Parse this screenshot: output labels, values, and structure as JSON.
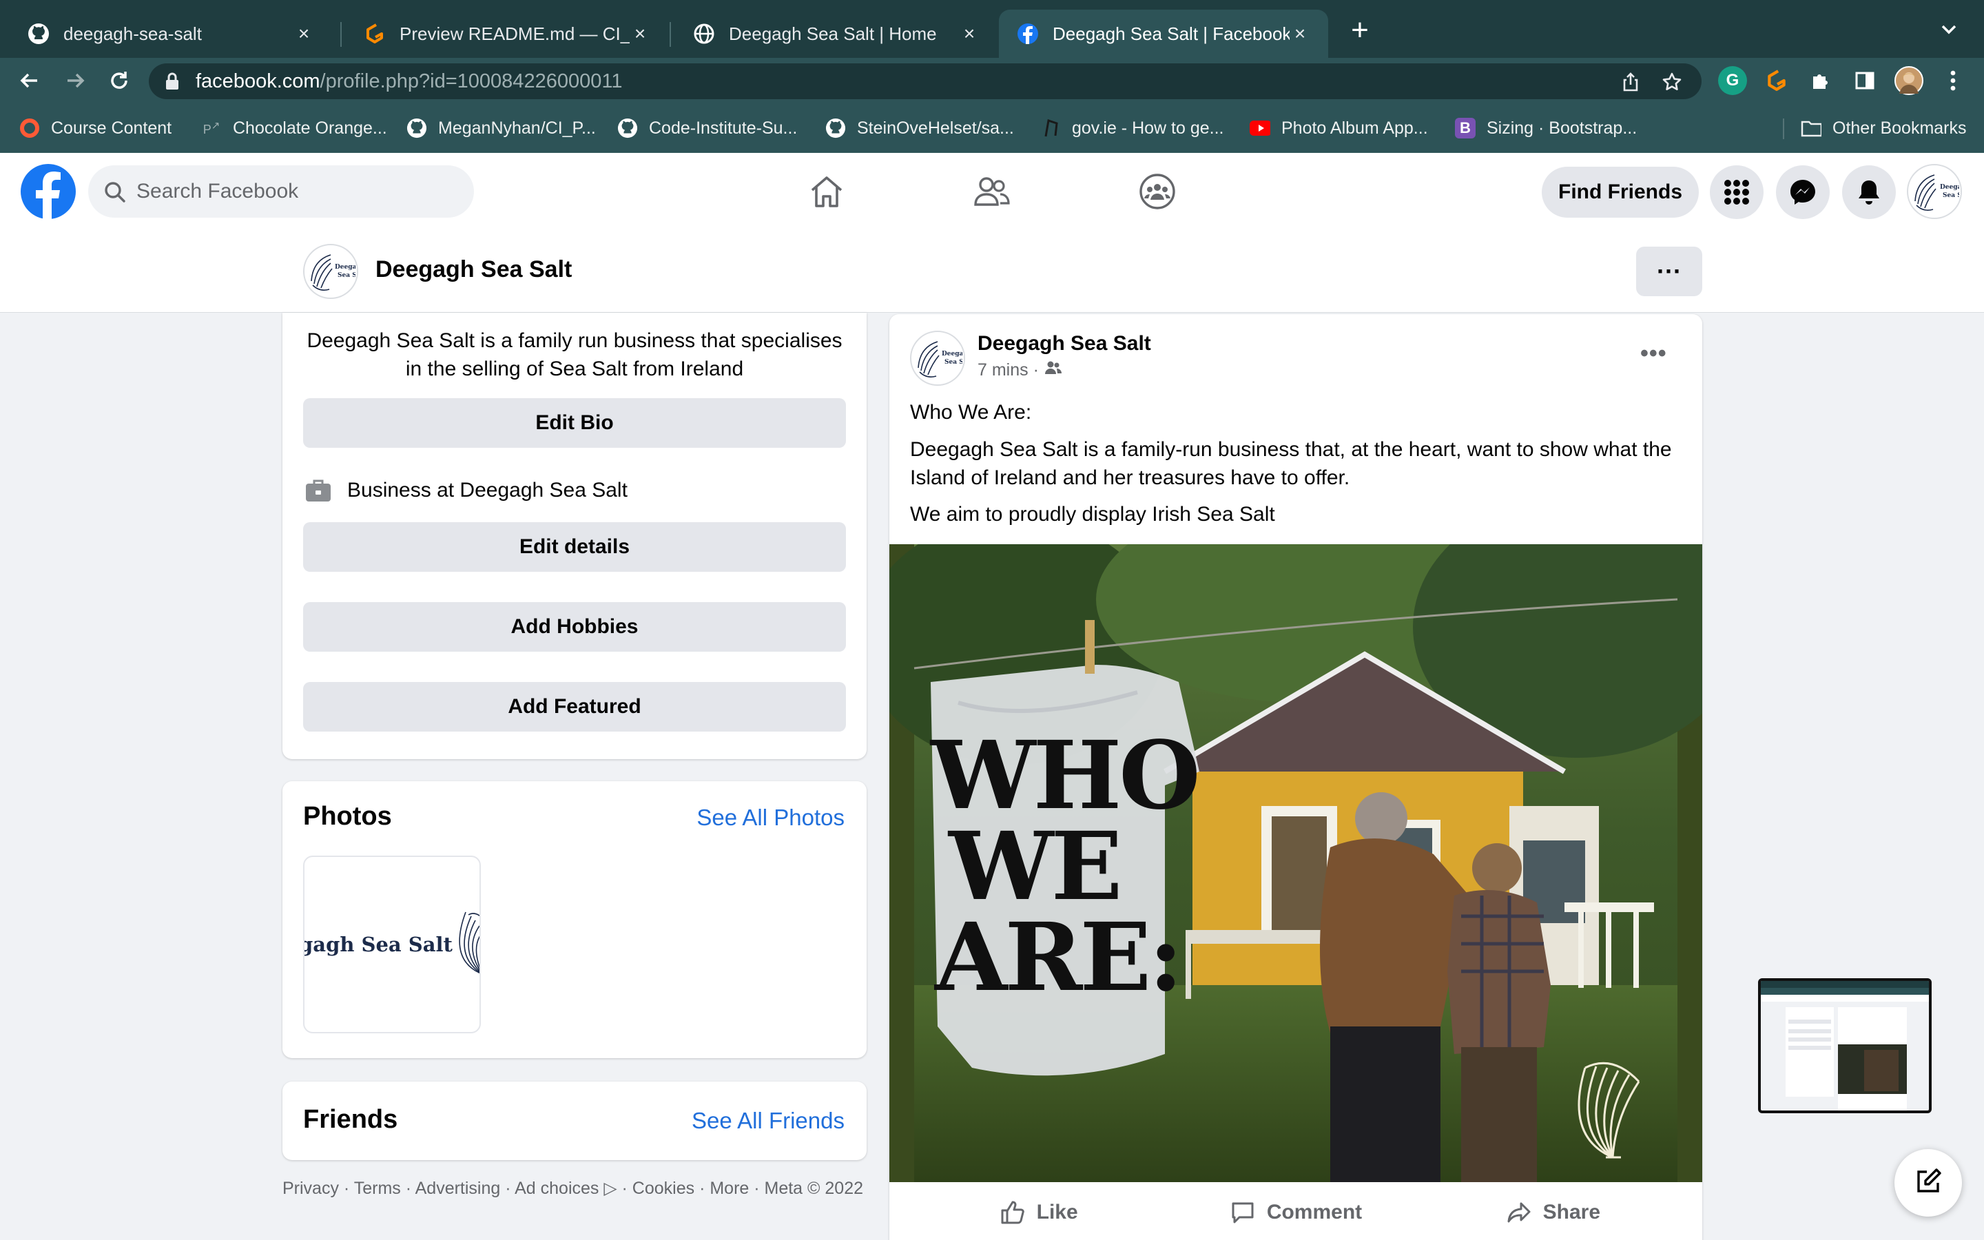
{
  "browser": {
    "tabs": [
      {
        "title": "deegagh-sea-salt",
        "icon": "github-icon"
      },
      {
        "title": "Preview README.md — CI_PP5",
        "icon": "gitpod-icon"
      },
      {
        "title": "Deegagh Sea Salt | Home",
        "icon": "globe-icon"
      },
      {
        "title": "Deegagh Sea Salt | Facebook",
        "icon": "facebook-icon"
      }
    ],
    "url_host": "facebook.com",
    "url_path": "/profile.php?id=100084226000011",
    "bookmarks": [
      {
        "label": "Course Content",
        "icon": "circle-icon"
      },
      {
        "label": "Chocolate Orange...",
        "icon": "pinterest-icon"
      },
      {
        "label": "MeganNyhan/CI_P...",
        "icon": "github-icon"
      },
      {
        "label": "Code-Institute-Su...",
        "icon": "github-icon"
      },
      {
        "label": "SteinOveHelset/sa...",
        "icon": "github-icon"
      },
      {
        "label": "gov.ie - How to ge...",
        "icon": "harp-icon"
      },
      {
        "label": "Photo Album App...",
        "icon": "youtube-icon"
      },
      {
        "label": "Sizing · Bootstrap...",
        "icon": "bootstrap-icon"
      }
    ],
    "other_bookmarks": "Other Bookmarks"
  },
  "facebook": {
    "search_placeholder": "Search Facebook",
    "find_friends": "Find Friends",
    "profile_name": "Deegagh Sea Salt",
    "more_label": "···"
  },
  "intro": {
    "bio": "Deegagh Sea Salt is a family run business that specialises in the selling of Sea Salt from Ireland",
    "edit_bio": "Edit Bio",
    "work": "Business at Deegagh Sea Salt",
    "edit_details": "Edit details",
    "add_hobbies": "Add Hobbies",
    "add_featured": "Add Featured"
  },
  "photos": {
    "title": "Photos",
    "see_all": "See All Photos",
    "thumb_text": "gagh Sea Salt"
  },
  "friends": {
    "title": "Friends",
    "see_all": "See All Friends"
  },
  "footer": {
    "text": "Privacy · Terms · Advertising · Ad choices ▷ · Cookies · More · Meta © 2022"
  },
  "post": {
    "author": "Deegagh Sea Salt",
    "time": "7 mins ·",
    "heading": "Who We Are:",
    "body": "Deegagh Sea Salt is a family-run business that, at the heart, want to show what the Island of Ireland and her treasures have to offer.",
    "tagline": "We aim to proudly display Irish Sea Salt",
    "image_overlay": [
      "WHO",
      "WE",
      "ARE:"
    ],
    "logo_text": "Deegagh Sea Salt",
    "actions": {
      "like": "Like",
      "comment": "Comment",
      "share": "Share"
    }
  },
  "colors": {
    "facebook_blue": "#1877f2",
    "link_blue": "#216fdb",
    "chrome_dark": "#1f3d40",
    "chrome_toolbar": "#2d5357"
  }
}
